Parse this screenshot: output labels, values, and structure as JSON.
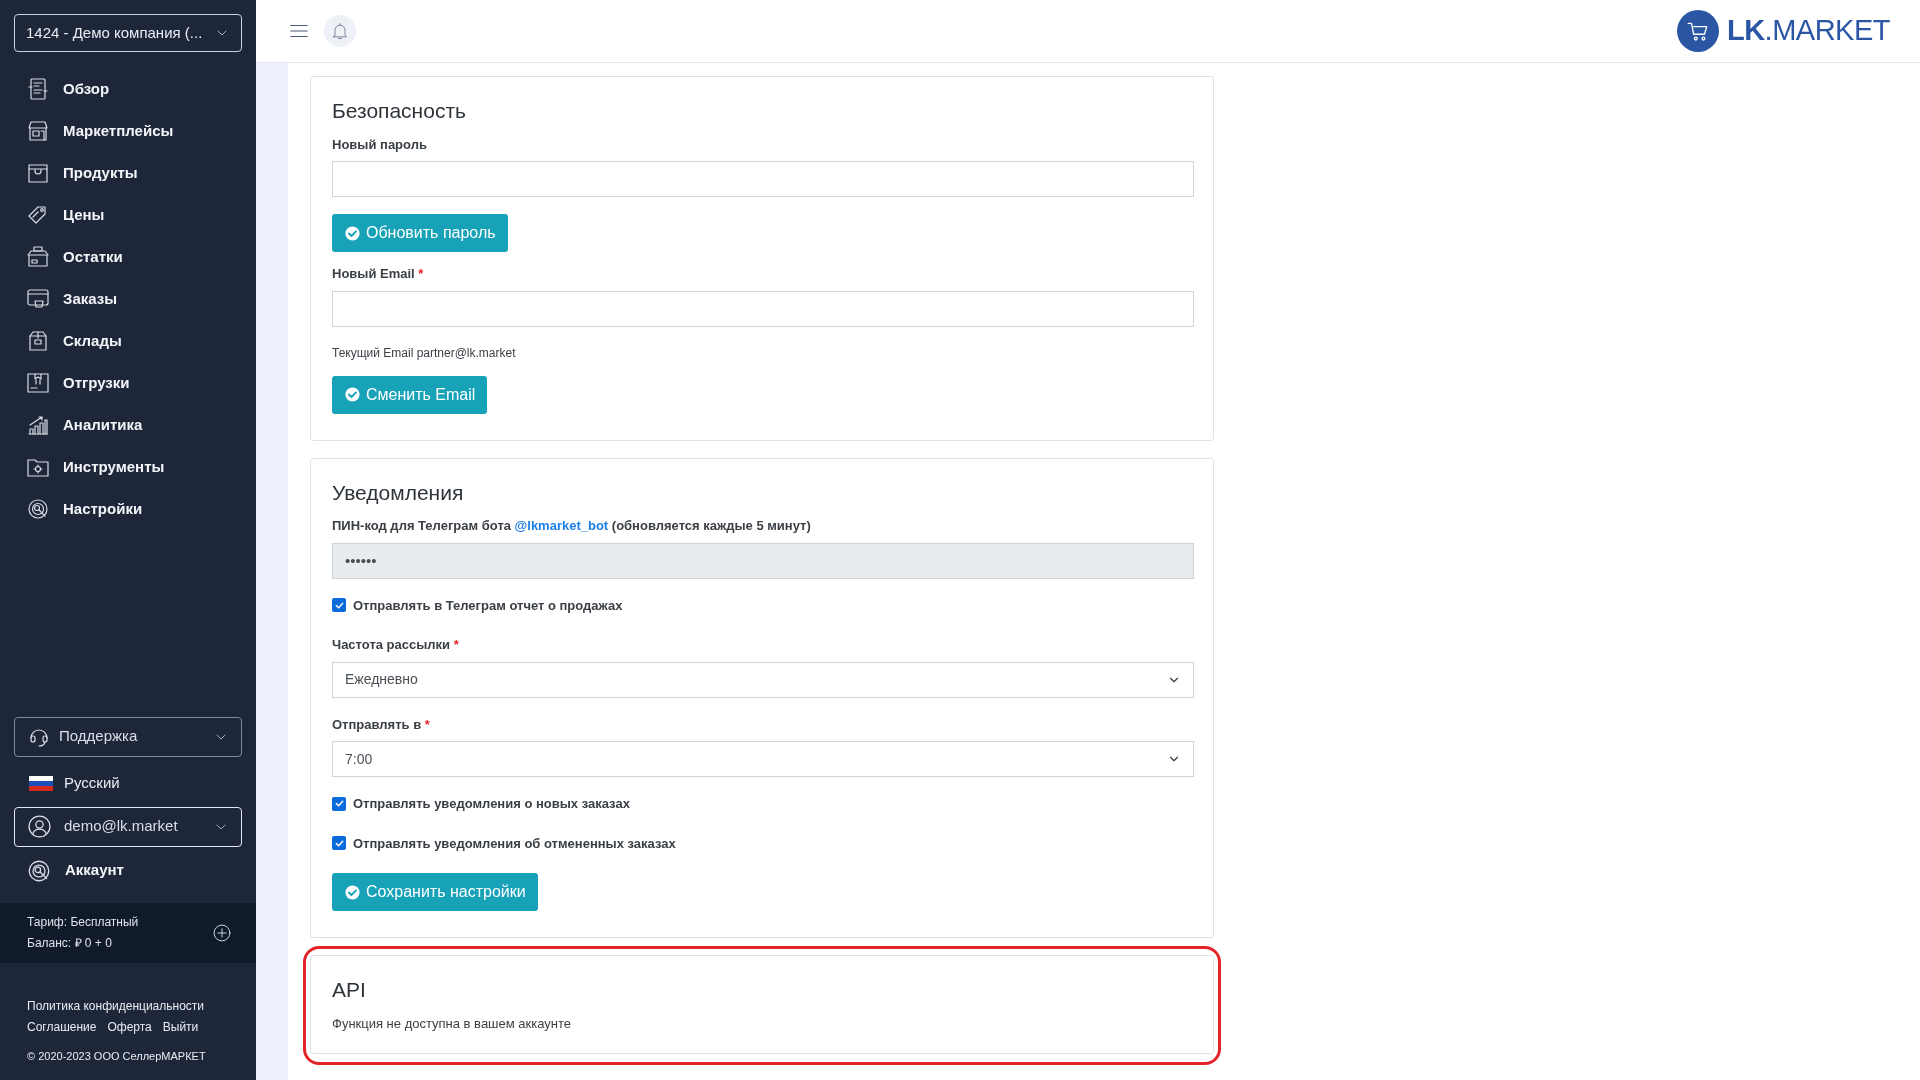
{
  "company_selector": {
    "value": "1424 - Демо компания (..."
  },
  "nav": [
    {
      "label": "Обзор"
    },
    {
      "label": "Маркетплейсы"
    },
    {
      "label": "Продукты"
    },
    {
      "label": "Цены"
    },
    {
      "label": "Остатки"
    },
    {
      "label": "Заказы"
    },
    {
      "label": "Склады"
    },
    {
      "label": "Отгрузки"
    },
    {
      "label": "Аналитика"
    },
    {
      "label": "Инструменты"
    },
    {
      "label": "Настройки"
    }
  ],
  "support": {
    "label": "Поддержка"
  },
  "language": {
    "label": "Русский"
  },
  "user": {
    "label": "demo@lk.market"
  },
  "account": {
    "label": "Аккаунт"
  },
  "plan": {
    "tariff": "Тариф: Бесплатный",
    "balance": "Баланс: ₽ 0 + 0"
  },
  "footer_links": [
    "Политика конфиденциальности",
    "Соглашение",
    "Оферта",
    "Выйти"
  ],
  "copyright": "© 2020-2023 ООО СеллерМАРКЕТ",
  "logo": {
    "text": "**LK**.MARKET"
  },
  "sections": [
    {
      "title": "Безопасность",
      "highlighted": false,
      "items": [
        {
          "kind": "input",
          "label": "Новый пароль"
        },
        {
          "kind": "button",
          "label": "Обновить пароль"
        },
        {
          "kind": "input",
          "label": "Новый Email",
          "required_mark": "*"
        },
        {
          "kind": "note",
          "text": "Текущий Email partner@lk.market"
        },
        {
          "kind": "button",
          "label": "Сменить Email"
        }
      ]
    },
    {
      "title": "Уведомления",
      "highlighted": false,
      "items": [
        {
          "kind": "input",
          "label": "ПИН-код для Телеграм бота ",
          "link": "@lkmarket_bot",
          "label_after": " (обновляется каждые 5 минут)",
          "value": "••••••",
          "disabled": true
        },
        {
          "kind": "checkbox",
          "label": "Отправлять в Телеграм отчет о продажах",
          "checked": true
        },
        {
          "kind": "select",
          "label": "Частота рассылки",
          "required_mark": "*",
          "value": "Ежедневно"
        },
        {
          "kind": "select",
          "label": "Отправлять в",
          "required_mark": "*",
          "value": "7:00"
        },
        {
          "kind": "checkbox",
          "label": "Отправлять уведомления о новых заказах",
          "checked": true
        },
        {
          "kind": "checkbox",
          "label": "Отправлять уведомления об отмененных заказах",
          "checked": true
        },
        {
          "kind": "button",
          "label": "Сохранить настройки"
        }
      ]
    },
    {
      "title": "API",
      "highlighted": true,
      "items": [
        {
          "kind": "note",
          "text": "Функция не доступна в вашем аккаунте"
        }
      ]
    }
  ]
}
